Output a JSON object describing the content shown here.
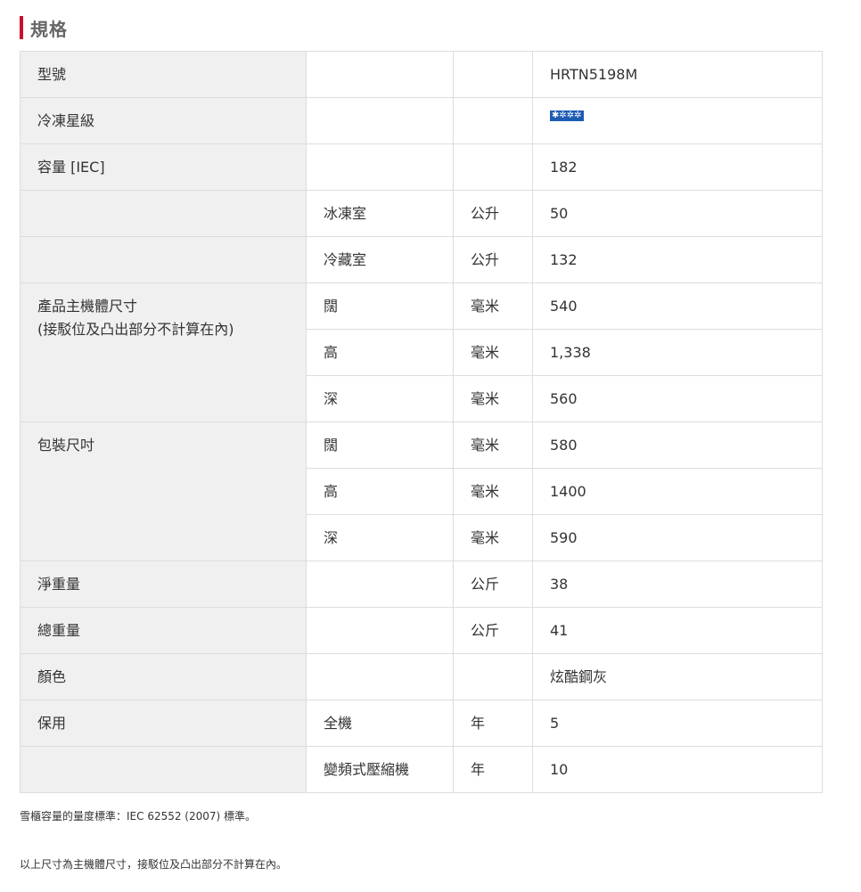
{
  "heading": "規格",
  "rows": [
    {
      "label": "型號",
      "sub": "",
      "unit": "",
      "value": "HRTN5198M"
    },
    {
      "label": "冷凍星級",
      "sub": "",
      "unit": "",
      "value": ""
    },
    {
      "label": "容量 [IEC]",
      "sub": "",
      "unit": "",
      "value": "182"
    },
    {
      "label": "",
      "sub": "冰凍室",
      "unit": "公升",
      "value": "50"
    },
    {
      "label": "",
      "sub": "冷藏室",
      "unit": "公升",
      "value": "132"
    },
    {
      "label": "產品主機體尺寸\n(接駁位及凸出部分不計算在內)",
      "sub": "闊",
      "unit": "毫米",
      "value": "540"
    },
    {
      "sub": "高",
      "unit": "毫米",
      "value": "1,338"
    },
    {
      "sub": "深",
      "unit": "毫米",
      "value": "560"
    },
    {
      "label": "包裝尺吋",
      "sub": "闊",
      "unit": "毫米",
      "value": "580"
    },
    {
      "sub": "高",
      "unit": "毫米",
      "value": "1400"
    },
    {
      "sub": "深",
      "unit": "毫米",
      "value": "590"
    },
    {
      "label": "淨重量",
      "sub": "",
      "unit": "公斤",
      "value": "38"
    },
    {
      "label": "總重量",
      "sub": "",
      "unit": "公斤",
      "value": "41"
    },
    {
      "label": "顏色",
      "sub": "",
      "unit": "",
      "value": "炫酷鋼灰"
    },
    {
      "label": "保用",
      "sub": "全機",
      "unit": "年",
      "value": "5"
    },
    {
      "label": "",
      "sub": "變頻式壓縮機",
      "unit": "年",
      "value": "10"
    }
  ],
  "freezer_rating_badge": "✱✲✲✲",
  "freezer_rating_icon": "freezer-star-rating-icon",
  "notes": [
    "雪櫃容量的量度標準：IEC 62552 (2007) 標準。",
    "以上尺寸為主機體尺寸，接駁位及凸出部分不計算在內。"
  ],
  "colors": {
    "accent": "#c8102e",
    "label_bg": "#f0f0f0",
    "border": "#dddddd",
    "badge": "#1e5cb3"
  }
}
